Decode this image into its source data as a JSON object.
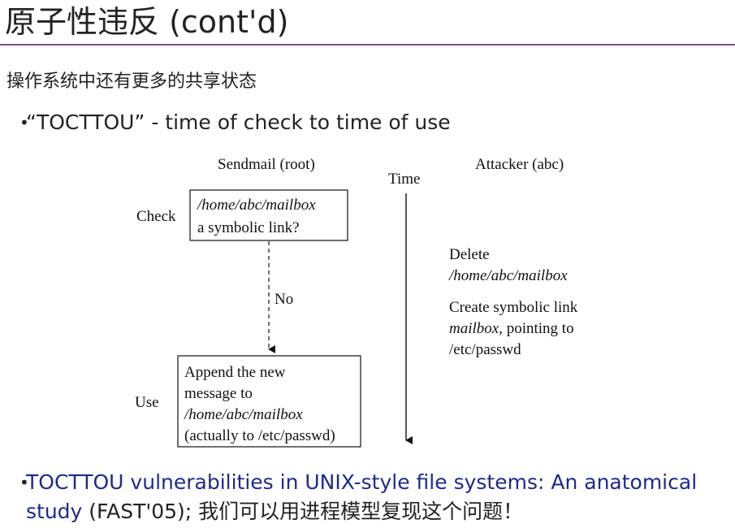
{
  "title": "原子性违反 (cont'd)",
  "subtitle": "操作系统中还有更多的共享状态",
  "bullet1": "“TOCTTOU” - time of check to time of use",
  "diagram": {
    "col_left": "Sendmail (root)",
    "col_time": "Time",
    "col_right": "Attacker (abc)",
    "check_label": "Check",
    "check_box_line1": "/home/abc/mailbox",
    "check_box_line2": "a symbolic link?",
    "no_label": "No",
    "use_label": "Use",
    "use_box_line1": "Append the new",
    "use_box_line2": "message to",
    "use_box_line3": "/home/abc/mailbox",
    "use_box_line4": "(actually to /etc/passwd)",
    "attacker_delete": "Delete",
    "attacker_delete_path": "/home/abc/mailbox",
    "attacker_create1": "Create symbolic link",
    "attacker_create2_it": "mailbox",
    "attacker_create2_rest": ", pointing to",
    "attacker_create3": "/etc/passwd"
  },
  "bullet2": {
    "link_text": "TOCTTOU vulnerabilities in UNIX-style file systems: An anatomical study",
    "rest": " (FAST'05); 我们可以用进程模型复现这个问题！"
  }
}
